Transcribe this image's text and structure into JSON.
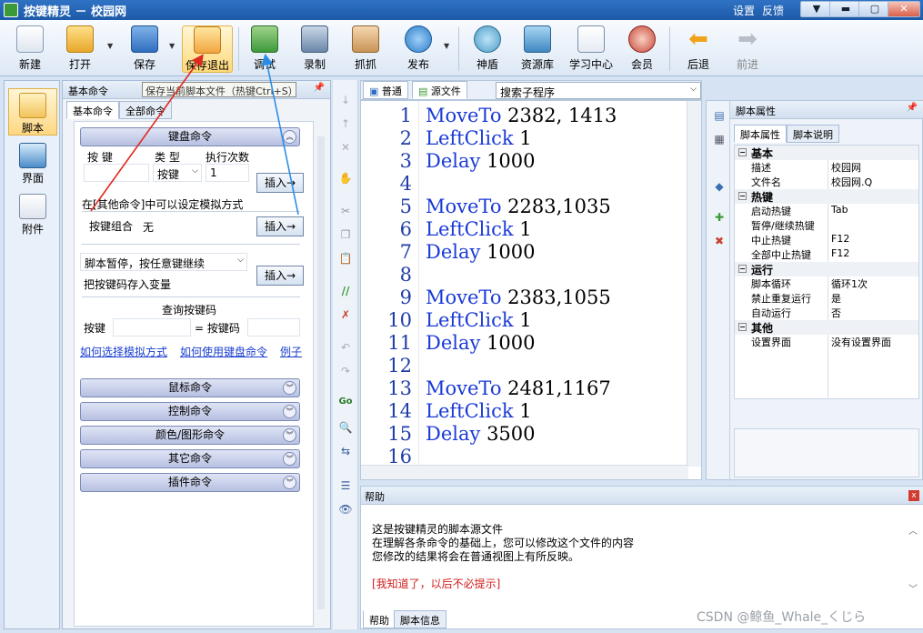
{
  "window": {
    "title": "按键精灵 － 校园网",
    "settings_link": "设置",
    "feedback_link": "反馈"
  },
  "toolbar": {
    "new": "新建",
    "open": "打开",
    "save": "保存",
    "save_exit": "保存退出",
    "debug": "调试",
    "record": "录制",
    "grab": "抓抓",
    "publish": "发布",
    "shendun": "神盾",
    "resources": "资源库",
    "learn": "学习中心",
    "member": "会员",
    "back": "后退",
    "forward": "前进"
  },
  "tooltip": "保存当前脚本文件（热键Ctrl+S）",
  "leftnav": {
    "script": "脚本",
    "ui": "界面",
    "attachment": "附件"
  },
  "basic_panel": {
    "header": "基本命令",
    "pin": "ᵖ",
    "tab_basic": "基本命令",
    "tab_all": "全部命令",
    "keyboard_category": "键盘命令",
    "key_label": "按 键",
    "type_label": "类 型",
    "exec_count_label": "执行次数",
    "type_value": "按键",
    "exec_count_value": "1",
    "insert": "插入→",
    "sim_note": "在[其他命令]中可以设定模拟方式",
    "combo_label": "按键组合",
    "combo_value": "无",
    "pause_select": "脚本暂停，按任意键继续",
    "store_key": "把按键码存入变量",
    "query_title": "查询按键码",
    "query_key": "按键",
    "query_code": "= 按键码",
    "link_sim": "如何选择模拟方式",
    "link_use": "如何使用键盘命令",
    "link_example": "例子",
    "categories": [
      "鼠标命令",
      "控制命令",
      "颜色/图形命令",
      "其它命令",
      "插件命令"
    ]
  },
  "editor": {
    "tab_normal": "普通",
    "tab_source": "源文件",
    "search_placeholder": "搜索子程序",
    "lines": [
      {
        "n": "1",
        "kw": "MoveTo",
        "arg": "2382, 1413"
      },
      {
        "n": "2",
        "kw": "LeftClick",
        "arg": "1"
      },
      {
        "n": "3",
        "kw": "Delay",
        "arg": "1000"
      },
      {
        "n": "4",
        "kw": "",
        "arg": ""
      },
      {
        "n": "5",
        "kw": "MoveTo",
        "arg": "2283,1035"
      },
      {
        "n": "6",
        "kw": "LeftClick",
        "arg": "1"
      },
      {
        "n": "7",
        "kw": "Delay",
        "arg": "1000"
      },
      {
        "n": "8",
        "kw": "",
        "arg": ""
      },
      {
        "n": "9",
        "kw": "MoveTo",
        "arg": "2383,1055"
      },
      {
        "n": "10",
        "kw": "LeftClick",
        "arg": "1"
      },
      {
        "n": "11",
        "kw": "Delay",
        "arg": "1000"
      },
      {
        "n": "12",
        "kw": "",
        "arg": ""
      },
      {
        "n": "13",
        "kw": "MoveTo",
        "arg": "2481,1167"
      },
      {
        "n": "14",
        "kw": "LeftClick",
        "arg": "1"
      },
      {
        "n": "15",
        "kw": "Delay",
        "arg": "3500"
      },
      {
        "n": "16",
        "kw": "",
        "arg": ""
      }
    ]
  },
  "help": {
    "title": "帮助",
    "line1": "这是按键精灵的脚本源文件",
    "line2": "在理解各条命令的基础上，您可以修改这个文件的内容",
    "line3": "您修改的结果将会在普通视图上有所反映。",
    "dismiss": "[我知道了，以后不必提示]",
    "tab_help": "帮助",
    "tab_info": "脚本信息"
  },
  "props": {
    "header": "脚本属性",
    "tab_props": "脚本属性",
    "tab_desc": "脚本说明",
    "rows": [
      {
        "cat": "基本"
      },
      {
        "k": "描述",
        "v": "校园网"
      },
      {
        "k": "文件名",
        "v": "校园网.Q"
      },
      {
        "cat": "热键"
      },
      {
        "k": "启动热键",
        "v": "Tab"
      },
      {
        "k": "暂停/继续热键",
        "v": ""
      },
      {
        "k": "中止热键",
        "v": "F12"
      },
      {
        "k": "全部中止热键",
        "v": "F12"
      },
      {
        "cat": "运行"
      },
      {
        "k": "脚本循环",
        "v": "循环1次"
      },
      {
        "k": "禁止重复运行",
        "v": "是"
      },
      {
        "k": "自动运行",
        "v": "否"
      },
      {
        "cat": "其他"
      },
      {
        "k": "设置界面",
        "v": "没有设置界面"
      }
    ]
  },
  "watermark": "CSDN @鲸鱼_Whale_くじら",
  "colors": {
    "accent": "#1a3ad6",
    "arrow_red": "#e0281e",
    "arrow_blue": "#2a8ee8"
  }
}
